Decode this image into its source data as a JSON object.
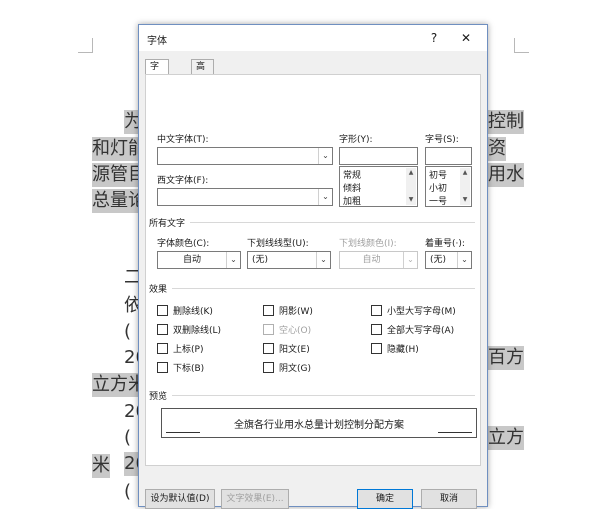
{
  "document": {
    "left_lines": [
      "为",
      "和灯能",
      "源管目",
      "总量论",
      "二",
      "依",
      "(",
      "20",
      "20",
      "立方米",
      "(",
      "20",
      "米",
      "("
    ],
    "right_lines": [
      "控制",
      "资",
      "用水",
      "百方",
      "立方"
    ]
  },
  "dialog": {
    "title": "字体",
    "help_label": "?",
    "close_label": "✕",
    "tabs": [
      {
        "label": "字体(N)"
      },
      {
        "label": "高级(V)"
      }
    ],
    "chinese_font": {
      "label": "中文字体(T):",
      "value": ""
    },
    "western_font": {
      "label": "西文字体(F):",
      "value": ""
    },
    "style": {
      "label": "字形(Y):",
      "value": "",
      "options": [
        "常规",
        "倾斜",
        "加粗"
      ]
    },
    "size": {
      "label": "字号(S):",
      "value": "",
      "options": [
        "初号",
        "小初",
        "一号"
      ]
    },
    "all_text": {
      "heading": "所有文字",
      "font_color": {
        "label": "字体颜色(C):",
        "value": "自动"
      },
      "underline_type": {
        "label": "下划线线型(U):",
        "value": "(无)"
      },
      "underline_color": {
        "label": "下划线颜色(I):",
        "value": "自动"
      },
      "emphasis": {
        "label": "着重号(·):",
        "value": "(无)"
      }
    },
    "effects": {
      "heading": "效果",
      "strikethrough": "删除线(K)",
      "double_strikethrough": "双删除线(L)",
      "superscript": "上标(P)",
      "subscript": "下标(B)",
      "shadow": "阴影(W)",
      "outline": "空心(O)",
      "emboss": "阳文(E)",
      "engrave": "阴文(G)",
      "small_caps": "小型大写字母(M)",
      "all_caps": "全部大写字母(A)",
      "hidden": "隐藏(H)"
    },
    "preview": {
      "heading": "预览",
      "text": "全旗各行业用水总量计划控制分配方案"
    },
    "buttons": {
      "default": "设为默认值(D)",
      "text_effects": "文字效果(E)...",
      "ok": "确定",
      "cancel": "取消"
    }
  }
}
